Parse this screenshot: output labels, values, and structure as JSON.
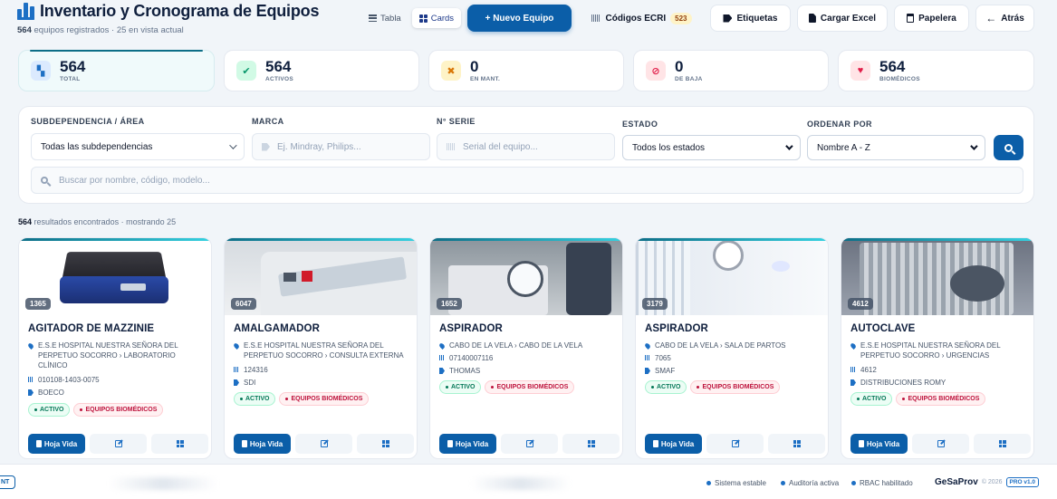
{
  "header": {
    "title": "Inventario y Cronograma de Equipos",
    "count": "564",
    "subtitle_rest": " equipos registrados · 25 en vista actual",
    "view_table": "Tabla",
    "view_cards": "Cards",
    "new_button": "+ Nuevo Equipo",
    "ecri_label": "Códigos ECRI",
    "ecri_count": "523",
    "labels_button": "Etiquetas",
    "excel_button": "Cargar Excel",
    "trash_button": "Papelera",
    "back_button": "Atrás"
  },
  "stats": [
    {
      "value": "564",
      "label": "TOTAL",
      "color": "#1d6fc4",
      "bg": "#dbeafe"
    },
    {
      "value": "564",
      "label": "ACTIVOS",
      "color": "#059669",
      "bg": "#d1fae5"
    },
    {
      "value": "0",
      "label": "EN MANT.",
      "color": "#d97706",
      "bg": "#fef3c7"
    },
    {
      "value": "0",
      "label": "DE BAJA",
      "color": "#e11d48",
      "bg": "#ffe4e6"
    },
    {
      "value": "564",
      "label": "BIOMÉDICOS",
      "color": "#e11d48",
      "bg": "#ffe4e6"
    }
  ],
  "filters": {
    "area_label": "SUBDEPENDENCIA / ÁREA",
    "area_value": "Todas las subdependencias",
    "brand_label": "MARCA",
    "brand_placeholder": "Ej. Mindray, Philips...",
    "serial_label": "N° SERIE",
    "serial_placeholder": "Serial del equipo...",
    "state_label": "ESTADO",
    "state_value": "Todos los estados",
    "order_label": "ORDENAR POR",
    "order_value": "Nombre A - Z",
    "search_placeholder": "Buscar por nombre, código, modelo..."
  },
  "results": {
    "count": "564",
    "rest": " resultados encontrados · mostrando 25"
  },
  "cards": [
    {
      "code": "1365",
      "title": "AGITADOR DE MAZZINIE",
      "location": "E.S.E HOSPITAL NUESTRA SEÑORA DEL PERPETUO SOCORRO › LABORATORIO CLÍNICO",
      "serial": "010108-1403-0075",
      "brand": "BOECO",
      "status": "ACTIVO",
      "type": "EQUIPOS BIOMÉDICOS"
    },
    {
      "code": "6047",
      "title": "AMALGAMADOR",
      "location": "E.S.E HOSPITAL NUESTRA SEÑORA DEL PERPETUO SOCORRO › CONSULTA EXTERNA",
      "serial": "124316",
      "brand": "SDI",
      "status": "ACTIVO",
      "type": "EQUIPOS BIOMÉDICOS"
    },
    {
      "code": "1652",
      "title": "ASPIRADOR",
      "location": "CABO DE LA VELA › CABO DE LA VELA",
      "serial": "07140007116",
      "brand": "THOMAS",
      "status": "ACTIVO",
      "type": "EQUIPOS BIOMÉDICOS"
    },
    {
      "code": "3179",
      "title": "ASPIRADOR",
      "location": "CABO DE LA VELA › SALA DE PARTOS",
      "serial": "7065",
      "brand": "SMAF",
      "status": "ACTIVO",
      "type": "EQUIPOS BIOMÉDICOS"
    },
    {
      "code": "4612",
      "title": "AUTOCLAVE",
      "location": "E.S.E HOSPITAL NUESTRA SEÑORA DEL PERPETUO SOCORRO › URGENCIAS",
      "serial": "4612",
      "brand": "DISTRIBUCIONES ROMY",
      "status": "ACTIVO",
      "type": "EQUIPOS BIOMÉDICOS"
    }
  ],
  "card_actions": {
    "sheet": "Hoja Vida"
  },
  "footer": {
    "left_tag": "NT",
    "status1": "Sistema estable",
    "status2": "Auditoría activa",
    "status3": "RBAC habilitado",
    "brand": "GeSaProv",
    "year": "© 2026",
    "version": "PRO v1.0"
  }
}
